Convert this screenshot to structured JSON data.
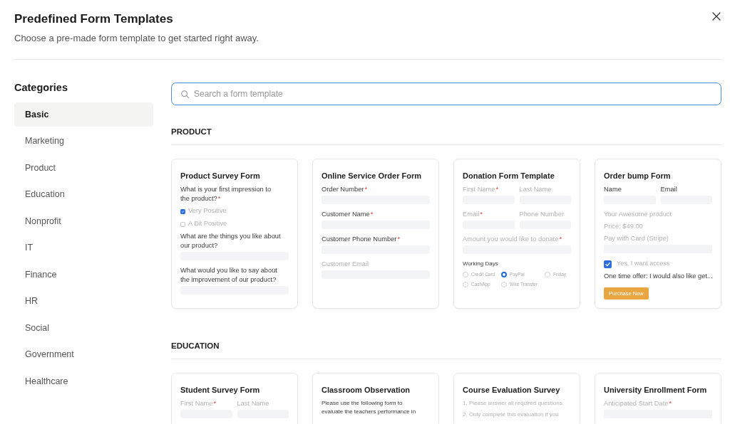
{
  "dialog": {
    "title": "Predefined Form Templates",
    "subtitle": "Choose a pre-made form template to get started right away."
  },
  "sidebar": {
    "heading": "Categories",
    "items": [
      {
        "label": "Basic",
        "selected": true
      },
      {
        "label": "Marketing",
        "selected": false
      },
      {
        "label": "Product",
        "selected": false
      },
      {
        "label": "Education",
        "selected": false
      },
      {
        "label": "Nonprofit",
        "selected": false
      },
      {
        "label": "IT",
        "selected": false
      },
      {
        "label": "Finance",
        "selected": false
      },
      {
        "label": "HR",
        "selected": false
      },
      {
        "label": "Social",
        "selected": false
      },
      {
        "label": "Government",
        "selected": false
      },
      {
        "label": "Healthcare",
        "selected": false
      }
    ]
  },
  "search": {
    "placeholder": "Search a form template"
  },
  "sections": [
    {
      "heading": "PRODUCT",
      "templates": [
        {
          "title": "Product Survey Form",
          "elements": [
            {
              "kind": "text",
              "text": "What is your first impression to\nthe product?",
              "mark": "*",
              "muted": false,
              "small": false
            },
            {
              "kind": "checkbox",
              "label": "Very Positive",
              "checked": true
            },
            {
              "kind": "checkbox",
              "label": "A Bit Positive",
              "checked": false
            },
            {
              "kind": "text",
              "text": "What are the things you like about\nour product?",
              "muted": false,
              "small": false
            },
            {
              "kind": "field"
            },
            {
              "kind": "text",
              "text": "What would you like to say about\nthe improvement of our product?",
              "muted": false,
              "small": false
            },
            {
              "kind": "field"
            }
          ]
        },
        {
          "title": "Online Service Order Form",
          "elements": [
            {
              "kind": "text",
              "text": "Order Number",
              "mark": "*",
              "muted": false,
              "small": false
            },
            {
              "kind": "field"
            },
            {
              "kind": "text",
              "text": "Customer Name",
              "mark": "*",
              "muted": false,
              "small": false
            },
            {
              "kind": "field"
            },
            {
              "kind": "text",
              "text": "Customer Phone Number",
              "mark": "*",
              "muted": false,
              "small": false
            },
            {
              "kind": "field"
            },
            {
              "kind": "text",
              "text": "Customer Email",
              "muted": true,
              "small": false
            },
            {
              "kind": "field"
            }
          ]
        },
        {
          "title": "Donation Form Template",
          "elements": [
            {
              "kind": "pair",
              "cells": [
                {
                  "text": "First Name",
                  "mark": "*",
                  "muted": true,
                  "small": false
                },
                {
                  "text": "Last Name",
                  "muted": true,
                  "small": false
                }
              ]
            },
            {
              "kind": "pair",
              "cells": [
                {
                  "text": "Email",
                  "mark": "*",
                  "muted": true,
                  "small": false
                },
                {
                  "text": "Phone Number",
                  "muted": true,
                  "small": false
                }
              ]
            },
            {
              "kind": "text",
              "text": "Amount you would like to donate",
              "mark": "*",
              "muted": true,
              "small": false
            },
            {
              "kind": "field"
            },
            {
              "kind": "text",
              "text": "Working Days",
              "muted": false,
              "small": true
            },
            {
              "kind": "radios",
              "options": [
                {
                  "label": "Credit Card",
                  "selected": false
                },
                {
                  "label": "PayPal",
                  "selected": true
                },
                {
                  "label": "Friday",
                  "selected": false
                },
                {
                  "label": "CashApp",
                  "selected": false
                },
                {
                  "label": "Wire Transfer",
                  "selected": false
                }
              ]
            }
          ]
        },
        {
          "title": "Order bump Form",
          "elements": [
            {
              "kind": "pair",
              "cells": [
                {
                  "text": "Name",
                  "muted": false,
                  "small": false
                },
                {
                  "text": "Email",
                  "muted": false,
                  "small": false
                }
              ]
            },
            {
              "kind": "text",
              "text": "Your Awesome product",
              "muted": true,
              "small": false
            },
            {
              "kind": "text",
              "text": "Price: $49.00",
              "muted": true,
              "small": false
            },
            {
              "kind": "text",
              "text": "Pay with Card (Stripe)",
              "muted": true,
              "small": false
            },
            {
              "kind": "field"
            },
            {
              "kind": "optin",
              "label": "Yes, I want access",
              "checked": true
            },
            {
              "kind": "text",
              "text": "One time offer: I would also like get...",
              "muted": false,
              "small": false
            },
            {
              "kind": "button",
              "label": "Purchase Now"
            }
          ]
        }
      ]
    },
    {
      "heading": "EDUCATION",
      "templates": [
        {
          "title": "Student Survey Form",
          "elements": [
            {
              "kind": "pair",
              "cells": [
                {
                  "text": "First Name",
                  "mark": "*",
                  "muted": true,
                  "small": false
                },
                {
                  "text": "Last Name",
                  "muted": true,
                  "small": false
                }
              ]
            }
          ]
        },
        {
          "title": "Classroom Observation",
          "elements": [
            {
              "kind": "text",
              "text": "Please use the following form to\nevaluate the teachers performance in",
              "muted": false,
              "small": true
            }
          ]
        },
        {
          "title": "Course Evaluation Survey",
          "elements": [
            {
              "kind": "text",
              "text": "1. Please answer all required questions.",
              "muted": true,
              "small": true
            },
            {
              "kind": "text",
              "text": "2. Only complete this evaluation if you",
              "muted": true,
              "small": true
            }
          ]
        },
        {
          "title": "University Enrollment Form",
          "elements": [
            {
              "kind": "text",
              "text": "Anticipated Start Date",
              "mark": "*",
              "muted": true,
              "small": false
            },
            {
              "kind": "field"
            }
          ]
        }
      ]
    }
  ]
}
